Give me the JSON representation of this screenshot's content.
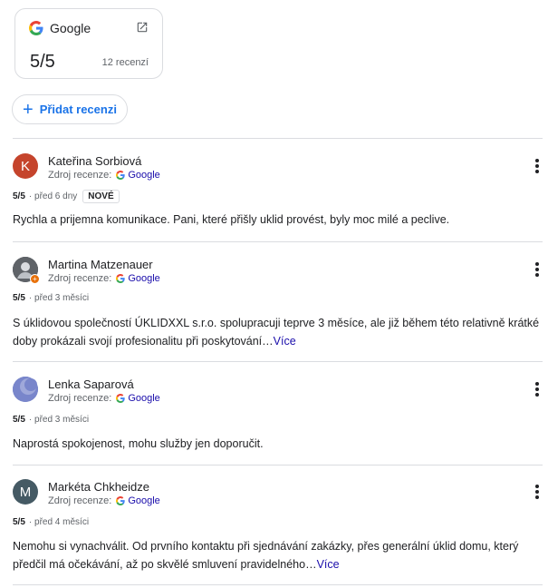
{
  "summary": {
    "source": "Google",
    "score": "5/5",
    "count": "12 recenzí"
  },
  "add_review": {
    "label": "Přidat recenzi"
  },
  "reviews": [
    {
      "initial": "K",
      "avatar_color": "#c5442c",
      "author": "Kateřina Sorbiová",
      "source_label": "Zdroj recenze:",
      "source_name": "Google",
      "score": "5/5",
      "time": "· před 6 dny",
      "badge": "NOVÉ",
      "text": "Rychla a prijemna komunikace. Pani, které přišly uklid provést, byly moc milé a peclive."
    },
    {
      "initial": "",
      "avatar_color": "#3c4043",
      "author": "Martina Matzenauer",
      "source_label": "Zdroj recenze:",
      "source_name": "Google",
      "score": "5/5",
      "time": "· před 3 měsíci",
      "text": "S úklidovou společností ÚKLIDXXL s.r.o. spolupracuji teprve 3 měsíce, ale již během této relativně krátké doby prokázali svojí profesionalitu při poskytování…",
      "more": "Více"
    },
    {
      "initial": "",
      "avatar_color": "#6a7fc1",
      "author": "Lenka Saparová",
      "source_label": "Zdroj recenze:",
      "source_name": "Google",
      "score": "5/5",
      "time": "· před 3 měsíci",
      "text": "Naprostá spokojenost, mohu služby jen doporučit."
    },
    {
      "initial": "M",
      "avatar_color": "#455a64",
      "author": "Markéta Chkheidze",
      "source_label": "Zdroj recenze:",
      "source_name": "Google",
      "score": "5/5",
      "time": "· před 4 měsíci",
      "text": "Nemohu si vynachválit. Od prvního kontaktu při sjednávání zakázky, přes generální úklid domu, který předčil má očekávání, až po skvělé smluvení pravidelného…",
      "more": "Více"
    }
  ]
}
